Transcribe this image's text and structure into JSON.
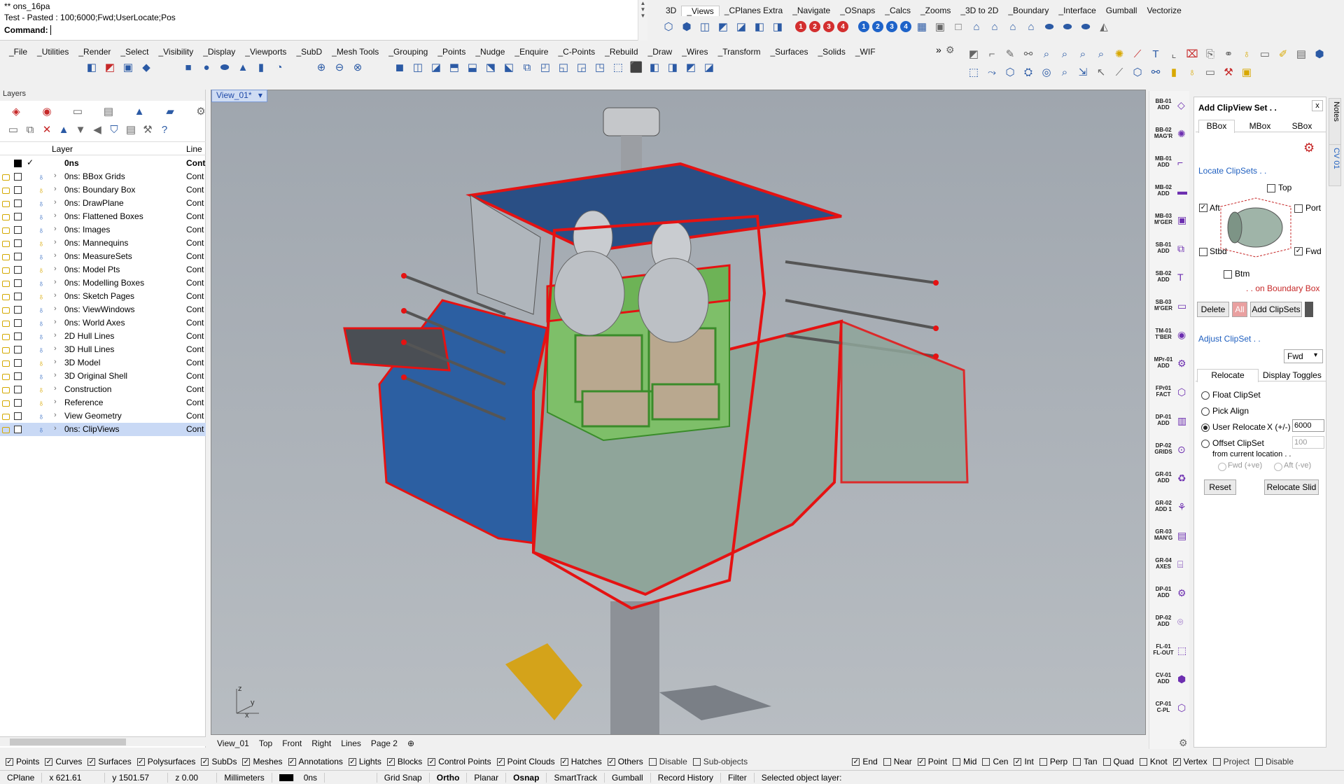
{
  "command": {
    "line1": "** ons_16pa",
    "line2": "Test - Pasted : 100;6000;Fwd;UserLocate;Pos",
    "prompt": "Command:"
  },
  "toptabs": [
    "3D",
    "_Views",
    "_CPlanes Extra",
    "_Navigate",
    "_OSnaps",
    "_Calcs",
    "_Zooms",
    "_3D to 2D",
    "_Boundary",
    "_Interface",
    "Gumball",
    "Vectorize"
  ],
  "midtabs": [
    "_File",
    "_Utilities",
    "_Render",
    "_Select",
    "_Visibility",
    "_Display",
    "_Viewports",
    "_SubD",
    "_Mesh Tools",
    "_Grouping",
    "_Points",
    "_Nudge",
    "_Enquire",
    "_C-Points",
    "_Rebuild",
    "_Draw",
    "_Wires",
    "_Transform",
    "_Surfaces",
    "_Solids",
    "_WIF"
  ],
  "numdots": {
    "red": [
      "1",
      "2",
      "3",
      "4"
    ],
    "blue": [
      "1",
      "2",
      "3",
      "4"
    ]
  },
  "layers": {
    "title": "Layers",
    "col_layer": "Layer",
    "col_line": "Line",
    "parent": "0ns",
    "parent_line": "Cont",
    "rows": [
      {
        "name": "0ns: BBox Grids",
        "line": "Cont",
        "bulb": "blue"
      },
      {
        "name": "0ns: Boundary Box",
        "line": "Cont",
        "bulb": "yellow"
      },
      {
        "name": "0ns: DrawPlane",
        "line": "Cont",
        "bulb": "blue"
      },
      {
        "name": "0ns: Flattened Boxes",
        "line": "Cont",
        "bulb": "blue"
      },
      {
        "name": "0ns: Images",
        "line": "Cont",
        "bulb": "blue"
      },
      {
        "name": "0ns: Mannequins",
        "line": "Cont",
        "bulb": "yellow"
      },
      {
        "name": "0ns: MeasureSets",
        "line": "Cont",
        "bulb": "blue"
      },
      {
        "name": "0ns: Model Pts",
        "line": "Cont",
        "bulb": "yellow"
      },
      {
        "name": "0ns: Modelling Boxes",
        "line": "Cont",
        "bulb": "blue"
      },
      {
        "name": "0ns: Sketch Pages",
        "line": "Cont",
        "bulb": "yellow"
      },
      {
        "name": "0ns: ViewWindows",
        "line": "Cont",
        "bulb": "blue"
      },
      {
        "name": "0ns: World Axes",
        "line": "Cont",
        "bulb": "blue"
      },
      {
        "name": "2D Hull Lines",
        "line": "Cont",
        "bulb": "blue"
      },
      {
        "name": "3D Hull Lines",
        "line": "Cont",
        "bulb": "blue"
      },
      {
        "name": "3D Model",
        "line": "Cont",
        "bulb": "yellow"
      },
      {
        "name": "3D Original Shell",
        "line": "Cont",
        "bulb": "blue"
      },
      {
        "name": "Construction",
        "line": "Cont",
        "bulb": "yellow"
      },
      {
        "name": "Reference",
        "line": "Cont",
        "bulb": "yellow"
      },
      {
        "name": "View Geometry",
        "line": "Cont",
        "bulb": "blue"
      },
      {
        "name": "0ns: ClipViews",
        "line": "Cont",
        "bulb": "blue",
        "selected": true
      }
    ]
  },
  "viewport": {
    "title": "View_01*",
    "axes": {
      "z": "z",
      "y": "y",
      "x": "x"
    }
  },
  "viewtabs": [
    "View_01",
    "Top",
    "Front",
    "Right",
    "Lines",
    "Page 2"
  ],
  "strip_labels": [
    "BB-01 ADD",
    "BB-02 MAG'R",
    "MB-01 ADD",
    "MB-02 ADD",
    "MB-03 M'GER",
    "SB-01 ADD",
    "SB-02 ADD",
    "SB-03 M'GER",
    "TM-01 T'BER",
    "MPr-01 ADD",
    "FPr01 FACT",
    "DP-01 ADD",
    "DP-02 GRIDS",
    "GR-01 ADD",
    "GR-02 ADD 1",
    "GR-03 MAN'G",
    "GR-04 AXES",
    "DP-01 ADD",
    "DP-02 ADD",
    "FL-01 FL-OUT",
    "CV-01 ADD",
    "CP-01 C-PL"
  ],
  "side_tabs": [
    "Notes",
    "CV 01"
  ],
  "clip": {
    "title": "Add ClipView Set . .",
    "close": "x",
    "tabs": [
      "BBox",
      "MBox",
      "SBox"
    ],
    "locate_label": "Locate ClipSets . .",
    "top": "Top",
    "aft": "Aft",
    "port": "Port",
    "stbd": "Stbd",
    "fwd": "Fwd",
    "btm": "Btm",
    "on_box": ". . on Boundary Box",
    "delete": "Delete",
    "all": "All",
    "add": "Add ClipSets",
    "adjust_label": "Adjust ClipSet . .",
    "adjust_select": "Fwd",
    "subtabs": [
      "Relocate",
      "Display Toggles"
    ],
    "float": "Float ClipSet",
    "pick": "Pick Align",
    "user": "User Relocate",
    "user_x": "X (+/-)",
    "user_val": "6000",
    "offset": "Offset ClipSet",
    "offset_val": "100",
    "from_current": "from current location . .",
    "fwd_ve": "Fwd (+ve)",
    "aft_ve": "Aft (-ve)",
    "reset": "Reset",
    "relocate": "Relocate Slid"
  },
  "filters": [
    {
      "label": "Points",
      "on": true
    },
    {
      "label": "Curves",
      "on": true
    },
    {
      "label": "Surfaces",
      "on": true
    },
    {
      "label": "Polysurfaces",
      "on": true
    },
    {
      "label": "SubDs",
      "on": true
    },
    {
      "label": "Meshes",
      "on": true
    },
    {
      "label": "Annotations",
      "on": true
    },
    {
      "label": "Lights",
      "on": true
    },
    {
      "label": "Blocks",
      "on": true
    },
    {
      "label": "Control Points",
      "on": true
    },
    {
      "label": "Point Clouds",
      "on": true
    },
    {
      "label": "Hatches",
      "on": true
    },
    {
      "label": "Others",
      "on": true
    },
    {
      "label": "Disable",
      "on": false
    },
    {
      "label": "Sub-objects",
      "on": false
    }
  ],
  "osnaps": [
    {
      "label": "End",
      "on": true
    },
    {
      "label": "Near",
      "on": false
    },
    {
      "label": "Point",
      "on": true
    },
    {
      "label": "Mid",
      "on": false
    },
    {
      "label": "Cen",
      "on": false
    },
    {
      "label": "Int",
      "on": true
    },
    {
      "label": "Perp",
      "on": false
    },
    {
      "label": "Tan",
      "on": false
    },
    {
      "label": "Quad",
      "on": false
    },
    {
      "label": "Knot",
      "on": false
    },
    {
      "label": "Vertex",
      "on": true
    },
    {
      "label": "Project",
      "on": false
    },
    {
      "label": "Disable",
      "on": false
    }
  ],
  "status": {
    "cplane": "CPlane",
    "x": "x 621.61",
    "y": "y 1501.57",
    "z": "z 0.00",
    "units": "Millimeters",
    "layer": "0ns",
    "toggles": [
      {
        "label": "Grid Snap",
        "bold": false
      },
      {
        "label": "Ortho",
        "bold": true
      },
      {
        "label": "Planar",
        "bold": false
      },
      {
        "label": "Osnap",
        "bold": true
      },
      {
        "label": "SmartTrack",
        "bold": false
      },
      {
        "label": "Gumball",
        "bold": false
      },
      {
        "label": "Record History",
        "bold": false
      },
      {
        "label": "Filter",
        "bold": false
      }
    ],
    "message": "Selected object layer:"
  }
}
